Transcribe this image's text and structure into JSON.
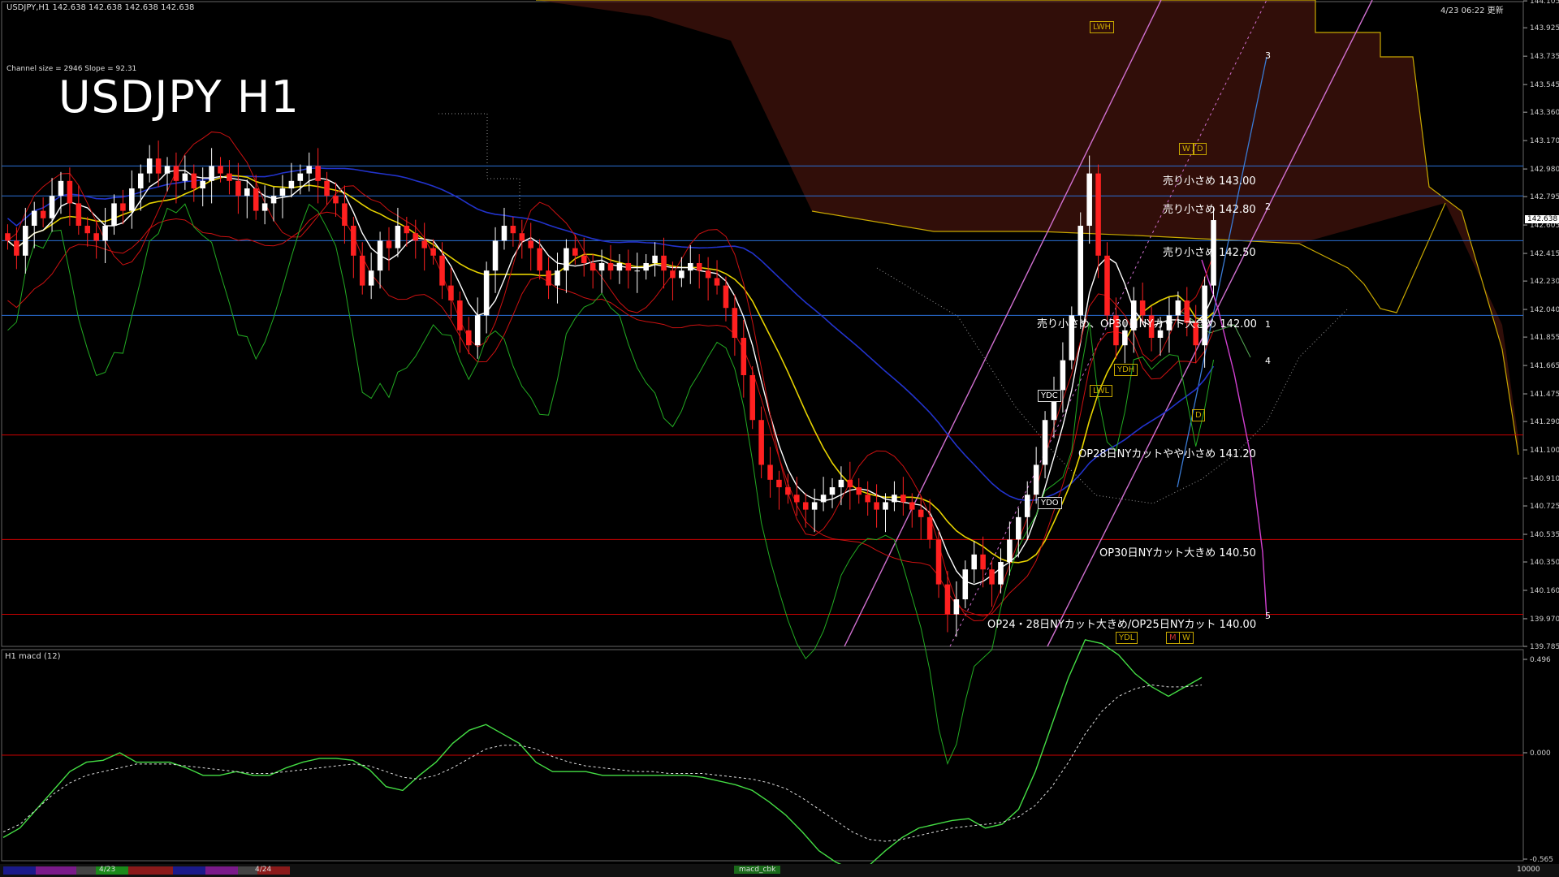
{
  "header": {
    "symbol_info": "USDJPY,H1  142.638 142.638 142.638 142.638",
    "timestamp": "4/23 06:22 更新",
    "channel_info": "Channel size = 2946 Slope = 92.31",
    "big_title": "USDJPY H1"
  },
  "chart_data": {
    "type": "candlestick",
    "symbol": "USDJPY",
    "timeframe": "H1",
    "ylim": [
      139.785,
      144.1
    ],
    "y_ticks": [
      144.105,
      143.925,
      143.735,
      143.545,
      143.36,
      143.17,
      142.98,
      142.795,
      142.605,
      142.415,
      142.23,
      142.04,
      141.855,
      141.665,
      141.475,
      141.29,
      141.1,
      140.91,
      140.725,
      140.535,
      140.35,
      140.16,
      139.97,
      139.785
    ],
    "current_price": "142.638",
    "closes": [
      142.5,
      142.4,
      142.6,
      142.7,
      142.65,
      142.8,
      142.9,
      142.75,
      142.6,
      142.55,
      142.5,
      142.6,
      142.75,
      142.7,
      142.85,
      142.95,
      143.05,
      142.95,
      143.0,
      142.9,
      142.95,
      142.85,
      142.9,
      143.0,
      142.95,
      142.9,
      142.8,
      142.85,
      142.7,
      142.75,
      142.8,
      142.85,
      142.9,
      142.95,
      143.0,
      142.9,
      142.8,
      142.75,
      142.6,
      142.4,
      142.2,
      142.3,
      142.5,
      142.45,
      142.6,
      142.55,
      142.5,
      142.45,
      142.4,
      142.2,
      142.1,
      141.9,
      141.8,
      142.0,
      142.3,
      142.5,
      142.6,
      142.55,
      142.5,
      142.45,
      142.3,
      142.2,
      142.3,
      142.45,
      142.4,
      142.35,
      142.3,
      142.35,
      142.3,
      142.35,
      142.3,
      142.3,
      142.35,
      142.4,
      142.3,
      142.25,
      142.3,
      142.35,
      142.3,
      142.25,
      142.2,
      142.05,
      141.85,
      141.6,
      141.3,
      141.0,
      140.9,
      140.85,
      140.8,
      140.75,
      140.7,
      140.75,
      140.8,
      140.85,
      140.9,
      140.85,
      140.8,
      140.75,
      140.7,
      140.75,
      140.8,
      140.75,
      140.7,
      140.65,
      140.5,
      140.2,
      140.0,
      140.1,
      140.3,
      140.4,
      140.3,
      140.2,
      140.35,
      140.5,
      140.65,
      140.8,
      141.0,
      141.3,
      141.5,
      141.7,
      142.0,
      142.6,
      142.95,
      142.4,
      142.0,
      141.8,
      141.9,
      142.1,
      142.0,
      141.85,
      141.9,
      142.0,
      142.1,
      141.95,
      141.8,
      142.2,
      142.638
    ],
    "h_lines": [
      {
        "price": 143.0,
        "color": "#2a6fd6"
      },
      {
        "price": 142.8,
        "color": "#2a6fd6"
      },
      {
        "price": 142.5,
        "color": "#2a6fd6"
      },
      {
        "price": 142.0,
        "color": "#2a6fd6"
      },
      {
        "price": 141.2,
        "color": "#cc0000"
      },
      {
        "price": 140.5,
        "color": "#cc0000"
      },
      {
        "price": 140.0,
        "color": "#cc0000"
      }
    ],
    "annotations": [
      {
        "text": "売り小さめ 143.00",
        "price": 143.0
      },
      {
        "text": "売り小さめ 142.80",
        "price": 142.8
      },
      {
        "text": "売り小さめ 142.50",
        "price": 142.5
      },
      {
        "text": "売り小さめ、OP30日NYカット大きめ 142.00",
        "price": 142.0
      },
      {
        "text": "OP28日NYカットやや小さめ 141.20",
        "price": 141.2
      },
      {
        "text": "OP30日NYカット大きめ 140.50",
        "price": 140.5
      },
      {
        "text": "OP24・28日NYカット大きめ/OP25日NYカット 140.00",
        "price": 140.0
      }
    ],
    "wave_labels": [
      "1",
      "2",
      "3",
      "4",
      "5"
    ],
    "level_boxes": [
      "LWH",
      "W",
      "D",
      "YDH",
      "YDC",
      "LWL",
      "D",
      "YDO",
      "YDL",
      "M",
      "W"
    ],
    "macd": {
      "label": "H1  macd (12)",
      "ylim": [
        -0.565,
        0.496
      ],
      "y_ticks": [
        0.496,
        0.0,
        -0.565
      ],
      "main": [
        -0.45,
        -0.4,
        -0.3,
        -0.2,
        -0.1,
        -0.05,
        -0.04,
        0.0,
        -0.05,
        -0.05,
        -0.05,
        -0.08,
        -0.12,
        -0.12,
        -0.1,
        -0.12,
        -0.12,
        -0.08,
        -0.05,
        -0.03,
        -0.03,
        -0.04,
        -0.09,
        -0.18,
        -0.2,
        -0.12,
        -0.05,
        0.05,
        0.12,
        0.15,
        0.1,
        0.05,
        -0.05,
        -0.1,
        -0.1,
        -0.1,
        -0.12,
        -0.12,
        -0.12,
        -0.12,
        -0.12,
        -0.12,
        -0.13,
        -0.15,
        -0.17,
        -0.2,
        -0.26,
        -0.33,
        -0.42,
        -0.52,
        -0.58,
        -0.62,
        -0.6,
        -0.52,
        -0.45,
        -0.4,
        -0.38,
        -0.36,
        -0.35,
        -0.4,
        -0.38,
        -0.3,
        -0.1,
        0.15,
        0.4,
        0.6,
        0.58,
        0.52,
        0.42,
        0.35,
        0.3,
        0.35,
        0.4
      ],
      "signal": [
        -0.42,
        -0.38,
        -0.3,
        -0.22,
        -0.16,
        -0.12,
        -0.1,
        -0.08,
        -0.06,
        -0.06,
        -0.06,
        -0.07,
        -0.08,
        -0.09,
        -0.1,
        -0.11,
        -0.11,
        -0.1,
        -0.09,
        -0.08,
        -0.07,
        -0.06,
        -0.07,
        -0.1,
        -0.13,
        -0.14,
        -0.12,
        -0.08,
        -0.03,
        0.02,
        0.04,
        0.04,
        0.02,
        -0.02,
        -0.05,
        -0.07,
        -0.08,
        -0.09,
        -0.1,
        -0.1,
        -0.11,
        -0.11,
        -0.11,
        -0.12,
        -0.13,
        -0.14,
        -0.16,
        -0.19,
        -0.24,
        -0.3,
        -0.36,
        -0.42,
        -0.46,
        -0.47,
        -0.46,
        -0.44,
        -0.42,
        -0.4,
        -0.39,
        -0.38,
        -0.37,
        -0.34,
        -0.28,
        -0.18,
        -0.05,
        0.1,
        0.22,
        0.3,
        0.34,
        0.36,
        0.35,
        0.35,
        0.36
      ]
    }
  },
  "bottom_bar": {
    "date_labels": [
      "4/23",
      "4/24"
    ],
    "indicator_label": "macd_cbk",
    "right_value": "10000"
  }
}
